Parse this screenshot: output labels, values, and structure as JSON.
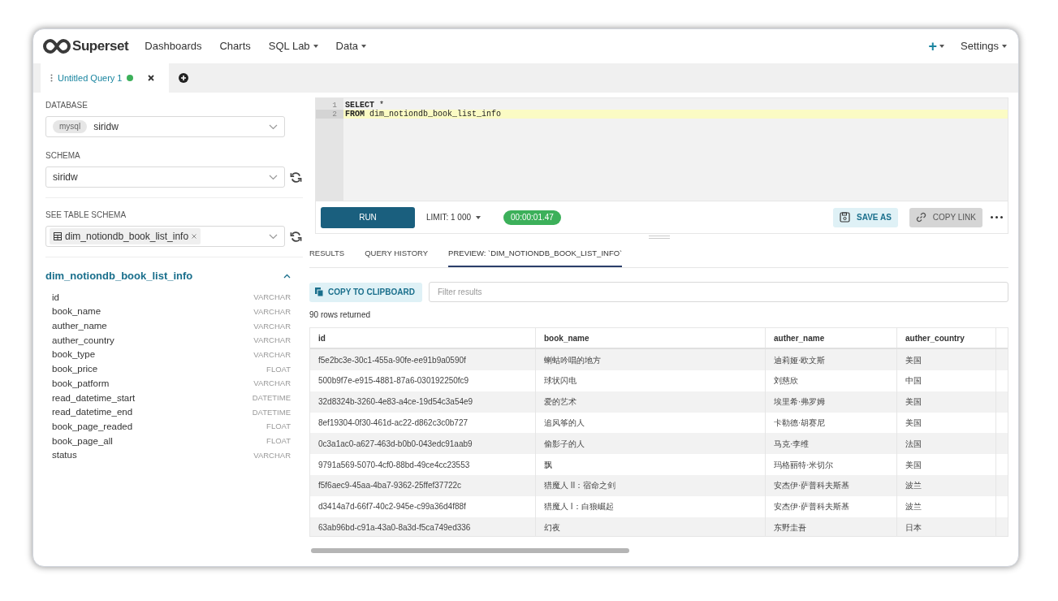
{
  "navbar": {
    "logo_text": "Superset",
    "items": [
      {
        "label": "Dashboards",
        "dropdown": false
      },
      {
        "label": "Charts",
        "dropdown": false
      },
      {
        "label": "SQL Lab",
        "dropdown": true
      },
      {
        "label": "Data",
        "dropdown": true
      }
    ],
    "new_button": "+",
    "settings": "Settings"
  },
  "query_tabs": [
    {
      "label": "Untitled Query 1",
      "selected": true
    }
  ],
  "left_panel": {
    "database": {
      "label": "DATABASE",
      "badge": "mysql",
      "value": "siridw"
    },
    "schema": {
      "label": "SCHEMA",
      "value": "siridw"
    },
    "table_schema": {
      "label": "SEE TABLE SCHEMA",
      "value": "dim_notiondb_book_list_info"
    },
    "table": {
      "name": "dim_notiondb_book_list_info",
      "expanded": true,
      "columns": [
        {
          "name": "id",
          "type": "VARCHAR"
        },
        {
          "name": "book_name",
          "type": "VARCHAR"
        },
        {
          "name": "auther_name",
          "type": "VARCHAR"
        },
        {
          "name": "auther_country",
          "type": "VARCHAR"
        },
        {
          "name": "book_type",
          "type": "VARCHAR"
        },
        {
          "name": "book_price",
          "type": "FLOAT"
        },
        {
          "name": "book_patform",
          "type": "VARCHAR"
        },
        {
          "name": "read_datetime_start",
          "type": "DATETIME"
        },
        {
          "name": "read_datetime_end",
          "type": "DATETIME"
        },
        {
          "name": "book_page_readed",
          "type": "FLOAT"
        },
        {
          "name": "book_page_all",
          "type": "FLOAT"
        },
        {
          "name": "status",
          "type": "VARCHAR"
        }
      ]
    }
  },
  "editor": {
    "lines": [
      {
        "number": "1",
        "keyword": "SELECT",
        "rest": " *",
        "highlighted": false
      },
      {
        "number": "2",
        "keyword": "FROM",
        "rest": " dim_notiondb_book_list_info",
        "highlighted": true
      }
    ]
  },
  "toolbar": {
    "run": "RUN",
    "limit_label": "LIMIT:",
    "limit_value": "1 000",
    "timer": "00:00:01.47",
    "save_as": "SAVE AS",
    "copy_link": "COPY LINK"
  },
  "result_tabs": [
    {
      "label": "RESULTS",
      "selected": false
    },
    {
      "label": "QUERY HISTORY",
      "selected": false
    },
    {
      "label": "PREVIEW: `DIM_NOTIONDB_BOOK_LIST_INFO`",
      "selected": true
    }
  ],
  "results": {
    "copy_button": "COPY TO CLIPBOARD",
    "filter": {
      "placeholder": "Filter results"
    },
    "rows_count": "90 rows returned",
    "table": {
      "columns": [
        "id",
        "book_name",
        "auther_name",
        "auther_country"
      ],
      "rows": [
        [
          "f5e2bc3e-30c1-455a-90fe-ee91b9a0590f",
          "蝲蛄吟唱的地方",
          "迪莉娅·欧文斯",
          "美国"
        ],
        [
          "500b9f7e-e915-4881-87a6-030192250fc9",
          "球状闪电",
          "刘慈欣",
          "中国"
        ],
        [
          "32d8324b-3260-4e83-a4ce-19d54c3a54e9",
          "爱的艺术",
          "埃里希·弗罗姆",
          "美国"
        ],
        [
          "8ef19304-0f30-461d-ac22-d862c3c0b727",
          "追风筝的人",
          "卡勒德·胡赛尼",
          "美国"
        ],
        [
          "0c3a1ac0-a627-463d-b0b0-043edc91aab9",
          "偷影子的人",
          "马克·李维",
          "法国"
        ],
        [
          "9791a569-5070-4cf0-88bd-49ce4cc23553",
          "飘",
          "玛格丽特·米切尔",
          "美国"
        ],
        [
          "f5f6aec9-45aa-4ba7-9362-25ffef37722c",
          "猎魔人 II：宿命之剑",
          "安杰伊·萨普科夫斯基",
          "波兰"
        ],
        [
          "d3414a7d-66f7-40c2-945e-c99a36d4f88f",
          "猎魔人 I：白狼崛起",
          "安杰伊·萨普科夫斯基",
          "波兰"
        ],
        [
          "63ab96bd-c91a-43a0-8a3d-f5ca749ed336",
          "幻夜",
          "东野圭吾",
          "日本"
        ]
      ]
    }
  }
}
